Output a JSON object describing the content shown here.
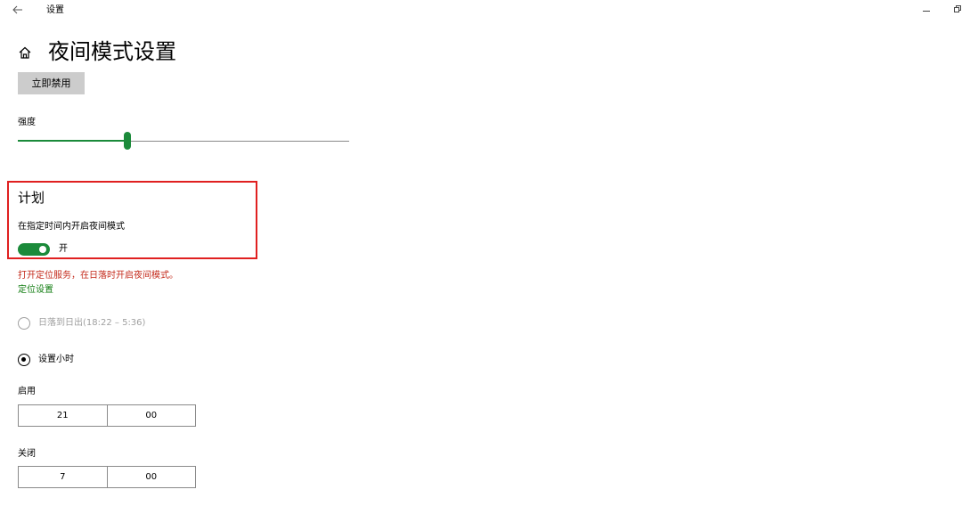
{
  "window": {
    "title": "设置"
  },
  "page": {
    "title": "夜间模式设置"
  },
  "actions": {
    "disable_now_label": "立即禁用"
  },
  "strength": {
    "label": "强度",
    "value_fraction": 0.33,
    "accent_color": "#1b8a3a",
    "track_color": "#8a8a8a"
  },
  "schedule": {
    "title": "计划",
    "toggle_label": "在指定时间内开启夜间模式",
    "toggle_state": "开",
    "toggle_on": true,
    "location_notice": "打开定位服务，在日落时开启夜间模式。",
    "location_link": "定位设置",
    "options": {
      "sunset_label": "日落到日出(18:22 – 5:36)",
      "set_hours_label": "设置小时"
    },
    "turn_on": {
      "label": "启用",
      "hour": "21",
      "minute": "00"
    },
    "turn_off": {
      "label": "关闭",
      "hour": "7",
      "minute": "00"
    }
  },
  "colors": {
    "accent": "#1b8a3a",
    "error": "#c42b1c",
    "link": "#107c10",
    "highlight_border": "#e02020"
  }
}
